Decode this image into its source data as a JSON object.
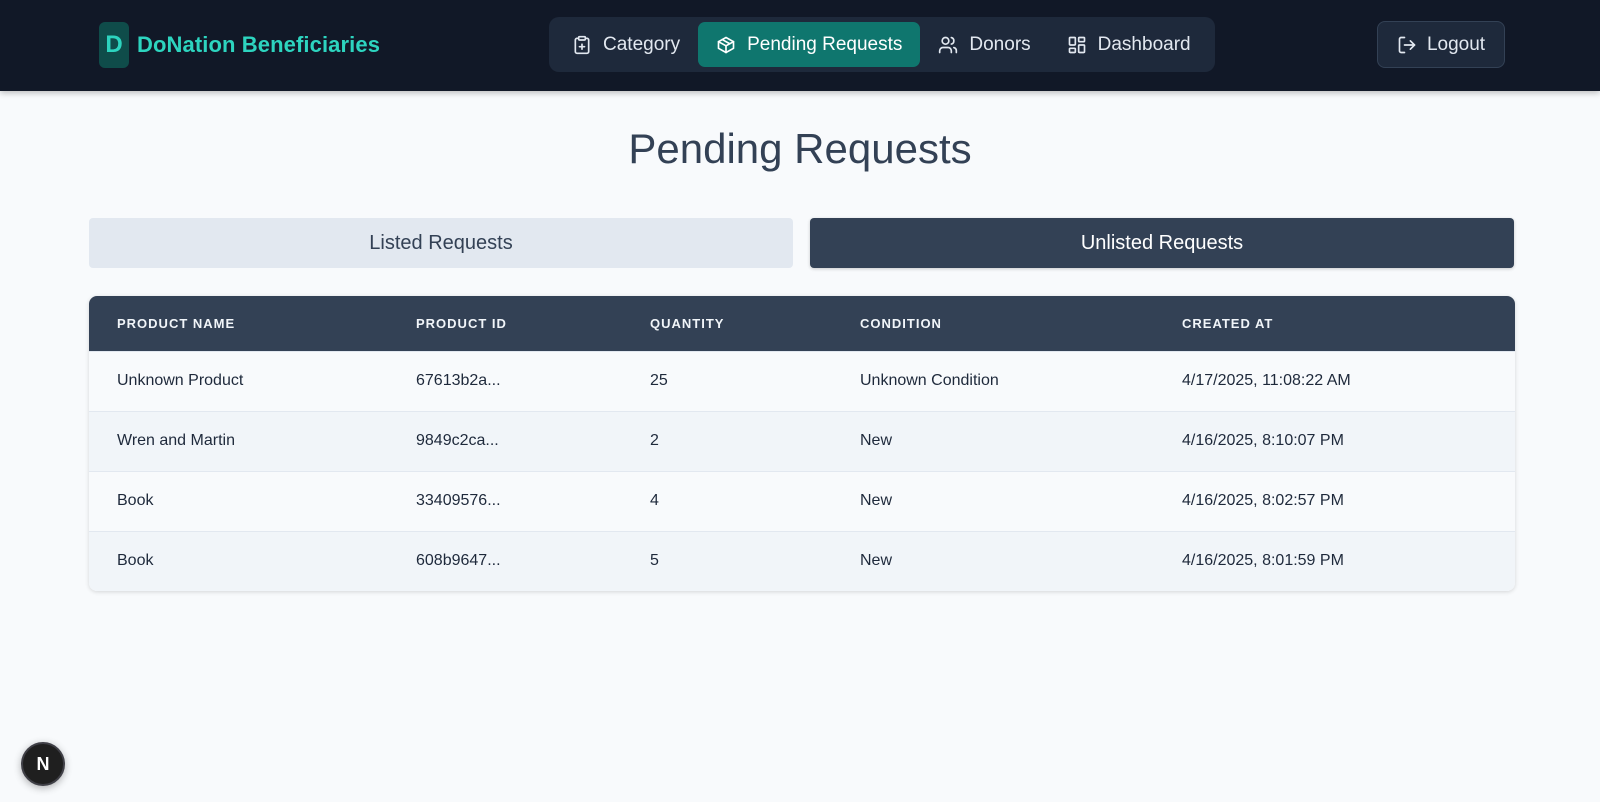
{
  "header": {
    "brand_letter": "D",
    "brand_name": "DoNation Beneficiaries",
    "nav": [
      {
        "label": "Category",
        "icon": "clipboard-plus-icon",
        "active": false
      },
      {
        "label": "Pending Requests",
        "icon": "package-icon",
        "active": true
      },
      {
        "label": "Donors",
        "icon": "users-icon",
        "active": false
      },
      {
        "label": "Dashboard",
        "icon": "dashboard-grid-icon",
        "active": false
      }
    ],
    "logout_label": "Logout",
    "accent_color": "#2dd4bf",
    "active_nav_color": "#0f766e"
  },
  "main": {
    "title": "Pending Requests",
    "tabs": [
      {
        "label": "Listed Requests",
        "selected": false
      },
      {
        "label": "Unlisted Requests",
        "selected": true
      }
    ],
    "table": {
      "columns": [
        "PRODUCT NAME",
        "PRODUCT ID",
        "QUANTITY",
        "CONDITION",
        "CREATED AT"
      ],
      "rows": [
        [
          "Unknown Product",
          "67613b2a...",
          "25",
          "Unknown Condition",
          "4/17/2025, 11:08:22 AM"
        ],
        [
          "Wren and Martin",
          "9849c2ca...",
          "2",
          "New",
          "4/16/2025, 8:10:07 PM"
        ],
        [
          "Book",
          "33409576...",
          "4",
          "New",
          "4/16/2025, 8:02:57 PM"
        ],
        [
          "Book",
          "608b9647...",
          "5",
          "New",
          "4/16/2025, 8:01:59 PM"
        ]
      ]
    }
  },
  "dev_badge_letter": "N"
}
